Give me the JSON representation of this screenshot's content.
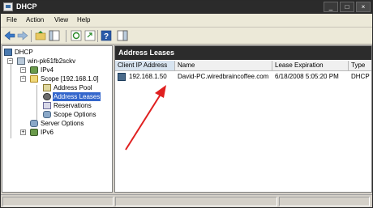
{
  "window": {
    "title": "DHCP",
    "minimize_glyph": "_",
    "maximize_glyph": "□",
    "close_glyph": "×"
  },
  "menu": {
    "items": [
      "File",
      "Action",
      "View",
      "Help"
    ]
  },
  "toolbar": {
    "icons": [
      "back-icon",
      "forward-icon",
      "up-folder-icon",
      "show-hide-tree-icon",
      "refresh-icon",
      "export-list-icon",
      "help-icon",
      "action-pane-icon"
    ]
  },
  "tree": {
    "root": "DHCP",
    "server": "win-pk61fb2sckv",
    "ipv4": "IPv4",
    "scope": "Scope [192.168.1.0]",
    "address_pool": "Address Pool",
    "address_leases": "Address Leases",
    "reservations": "Reservations",
    "scope_options": "Scope Options",
    "server_options": "Server Options",
    "ipv6": "IPv6",
    "expanded_glyph": "−",
    "collapsed_glyph": "+"
  },
  "right_pane": {
    "header": "Address Leases",
    "columns": [
      "Client IP Address",
      "Name",
      "Lease Expiration",
      "Type"
    ],
    "rows": [
      {
        "ip": "192.168.1.50",
        "name": "David-PC.wiredbraincoffee.com",
        "expiration": "6/18/2008 5:05:20 PM",
        "type": "DHCP"
      }
    ]
  },
  "annotation": {
    "arrow_color": "#e02020"
  }
}
